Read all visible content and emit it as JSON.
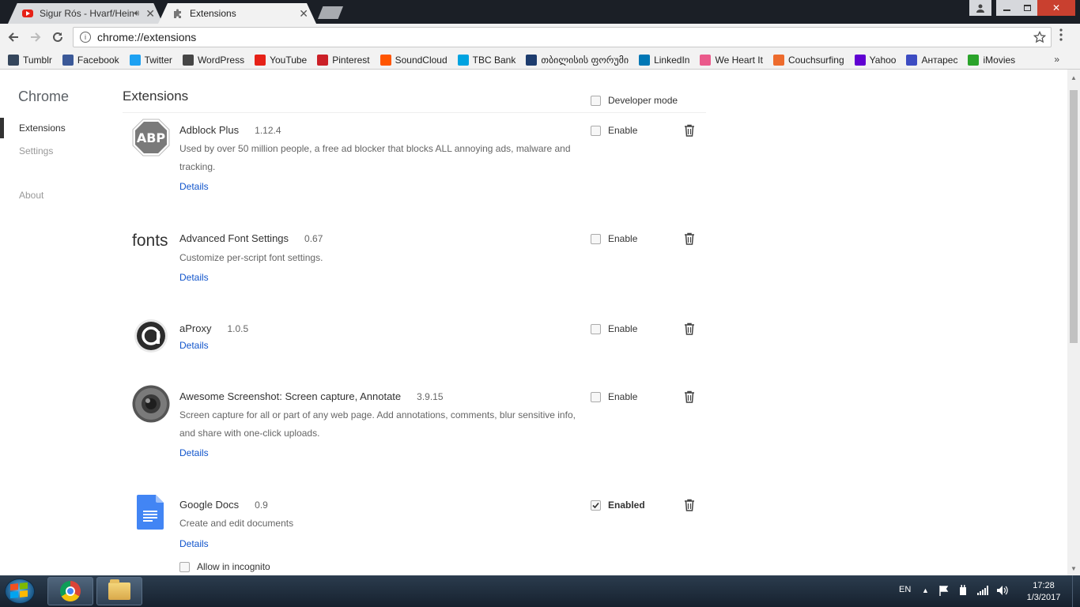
{
  "browser": {
    "tabs": [
      {
        "title": "Sigur Rós - Hvarf/Heim",
        "icon": "youtube-icon"
      },
      {
        "title": "Extensions",
        "icon": "puzzle-icon"
      }
    ],
    "close_glyph": "✕",
    "omnibox": {
      "url": "chrome://extensions",
      "info_glyph": "i"
    },
    "bookmarks": [
      {
        "label": "Tumblr",
        "color": "#35465c"
      },
      {
        "label": "Facebook",
        "color": "#3b5998"
      },
      {
        "label": "Twitter",
        "color": "#1da1f2"
      },
      {
        "label": "WordPress",
        "color": "#464646"
      },
      {
        "label": "YouTube",
        "color": "#e62117"
      },
      {
        "label": "Pinterest",
        "color": "#cb2027"
      },
      {
        "label": "SoundCloud",
        "color": "#ff5500"
      },
      {
        "label": "TBC Bank",
        "color": "#00a3e0"
      },
      {
        "label": "თბილისის ფორუმი",
        "color": "#1d3c6e"
      },
      {
        "label": "LinkedIn",
        "color": "#0077b5"
      },
      {
        "label": "We Heart It",
        "color": "#ea5a8b"
      },
      {
        "label": "Couchsurfing",
        "color": "#ed6b2d"
      },
      {
        "label": "Yahoo",
        "color": "#6001d2"
      },
      {
        "label": "Антарес",
        "color": "#3d4cc2"
      },
      {
        "label": "iMovies",
        "color": "#2aa32a"
      }
    ],
    "bookmarks_overflow": "»"
  },
  "sidebar": {
    "title": "Chrome",
    "items": [
      {
        "label": "Extensions",
        "selected": true
      },
      {
        "label": "Settings",
        "selected": false
      },
      {
        "label": "About",
        "selected": false
      }
    ]
  },
  "main": {
    "title": "Extensions",
    "developer_mode_label": "Developer mode",
    "details_label": "Details",
    "extensions": [
      {
        "name": "Adblock Plus",
        "version": "1.12.4",
        "description": "Used by over 50 million people, a free ad blocker that blocks ALL annoying ads, malware and tracking.",
        "enable_label": "Enable",
        "enabled": false,
        "icon": "abp-icon",
        "icon_text": "ABP"
      },
      {
        "name": "Advanced Font Settings",
        "version": "0.67",
        "description": "Customize per-script font settings.",
        "enable_label": "Enable",
        "enabled": false,
        "icon": "fonts-icon",
        "icon_text": "fonts"
      },
      {
        "name": "aProxy",
        "version": "1.0.5",
        "description": "",
        "enable_label": "Enable",
        "enabled": false,
        "icon": "aproxy-icon",
        "icon_text": "a"
      },
      {
        "name": "Awesome Screenshot: Screen capture, Annotate",
        "version": "3.9.15",
        "description": "Screen capture for all or part of any web page. Add annotations, comments, blur sensitive info, and share with one-click uploads.",
        "enable_label": "Enable",
        "enabled": false,
        "icon": "camera-lens-icon"
      },
      {
        "name": "Google Docs",
        "version": "0.9",
        "description": "Create and edit documents",
        "enable_label": "Enabled",
        "enabled": true,
        "icon": "google-docs-icon",
        "incognito_label": "Allow in incognito"
      }
    ]
  },
  "taskbar": {
    "language": "EN",
    "time": "17:28",
    "date": "1/3/2017"
  }
}
